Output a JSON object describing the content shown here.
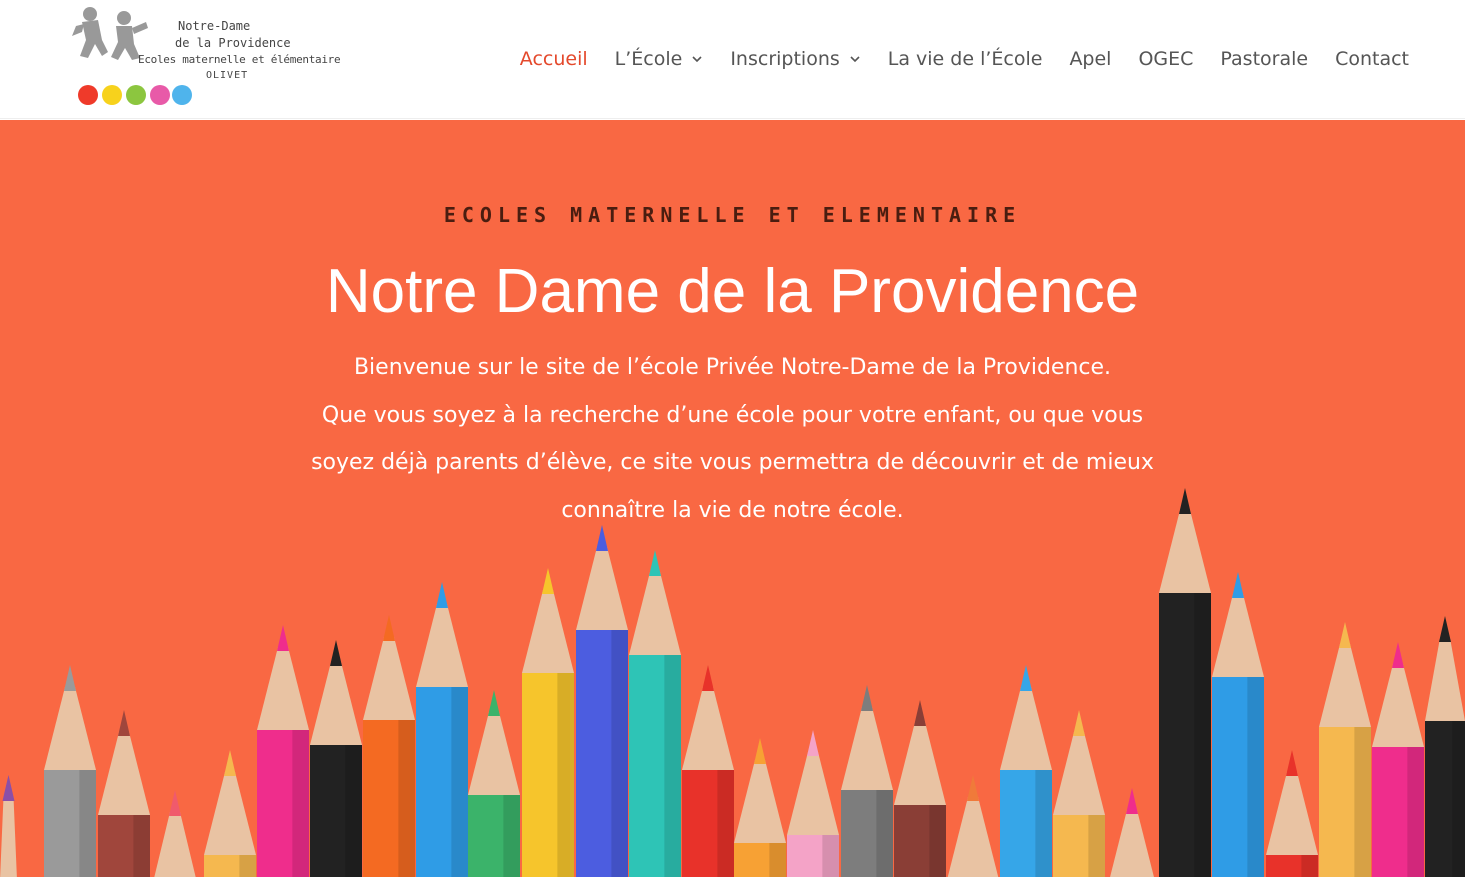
{
  "logo": {
    "line1": "Notre-Dame",
    "line2": "de la Providence",
    "line3": "Ecoles maternelle et élémentaire",
    "line4": "OLIVET",
    "dot_colors": [
      "#ef3a2a",
      "#f7d21c",
      "#8cc63f",
      "#e85aa8",
      "#4fb4ec"
    ]
  },
  "nav": {
    "items": [
      {
        "label": "Accueil",
        "active": true,
        "dropdown": false
      },
      {
        "label": "L’École",
        "active": false,
        "dropdown": true
      },
      {
        "label": "Inscriptions",
        "active": false,
        "dropdown": true
      },
      {
        "label": "La vie de l’École",
        "active": false,
        "dropdown": false
      },
      {
        "label": "Apel",
        "active": false,
        "dropdown": false
      },
      {
        "label": "OGEC",
        "active": false,
        "dropdown": false
      },
      {
        "label": "Pastorale",
        "active": false,
        "dropdown": false
      },
      {
        "label": "Contact",
        "active": false,
        "dropdown": false
      }
    ]
  },
  "hero": {
    "kicker": "ECOLES MATERNELLE ET ELEMENTAIRE",
    "title": "Notre Dame de la Providence",
    "intro_line1": "Bienvenue sur le site de l’école Privée Notre-Dame de la Providence.",
    "intro_line2": "Que vous soyez à la recherche d’une école pour votre enfant, ou que vous",
    "intro_line3": "soyez déjà parents d’élève, ce site vous permettra de découvrir et de mieux",
    "intro_line4": "connaître la vie de notre école.",
    "background_color": "#f96843",
    "accent_color": "#e4492c",
    "pencil_colors": [
      "#8b4fa8",
      "#9a9a9a",
      "#a0463c",
      "#f05a6c",
      "#f5b84f",
      "#ef2d8c",
      "#222222",
      "#f46a22",
      "#2f9ce6",
      "#3bb36a",
      "#f6c52c",
      "#4c5de0",
      "#2ec4b6",
      "#e8322a",
      "#f7a134",
      "#f4a3c7",
      "#7d7d7d",
      "#8a3e36",
      "#f07a3a",
      "#36a6e8",
      "#f5b84f",
      "#ef2d8c",
      "#222222"
    ]
  }
}
